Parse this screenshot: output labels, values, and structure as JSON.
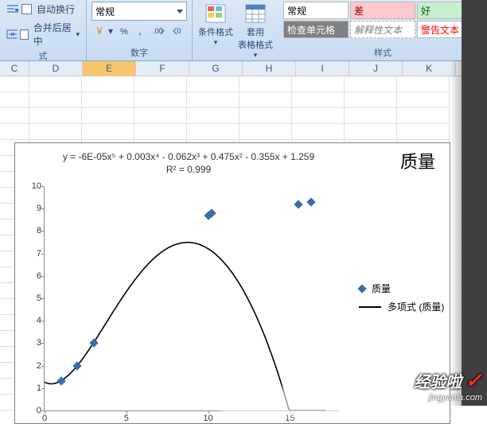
{
  "ribbon": {
    "align": {
      "wrap_label": "自动换行",
      "merge_label": "合并后居中",
      "group_label": "式"
    },
    "number": {
      "format_value": "常规",
      "group_label": "数字"
    },
    "format_btns": {
      "cond_format": "条件格式",
      "table_format_line1": "套用",
      "table_format_line2": "表格格式"
    },
    "styles": {
      "normal": "常规",
      "bad": "差",
      "good": "好",
      "check_cell": "检查单元格",
      "explain": "解释性文本",
      "warn": "警告文本",
      "group_label": "样式"
    }
  },
  "columns": [
    "C",
    "D",
    "E",
    "F",
    "G",
    "H",
    "I",
    "J",
    "K"
  ],
  "selected_column_index": 2,
  "chart_data": {
    "type": "scatter",
    "title": "质量",
    "equation_line1": "y = -6E-05x⁵ + 0.003x⁴ - 0.062x³ + 0.475x² - 0.355x + 1.259",
    "equation_line2": "R² = 0.999",
    "xlim": [
      0,
      18
    ],
    "ylim": [
      0,
      10
    ],
    "xticks": [
      0,
      5,
      10,
      15
    ],
    "yticks": [
      0,
      1,
      2,
      3,
      4,
      5,
      6,
      7,
      8,
      9,
      10
    ],
    "series": [
      {
        "name": "质量",
        "type": "points",
        "x": [
          1,
          2,
          3,
          10,
          10.2,
          15.5,
          16.3
        ],
        "y": [
          1.3,
          2.0,
          3.0,
          8.7,
          8.8,
          9.2,
          9.3
        ]
      },
      {
        "name": "多项式 (质量)",
        "type": "line",
        "coeffs": [
          -6e-05,
          0.003,
          -0.062,
          0.475,
          -0.355,
          1.259
        ]
      }
    ],
    "legend": {
      "entries": [
        "质量",
        "多项式 (质量)"
      ]
    }
  },
  "watermark": {
    "brand": "经验啦",
    "url": "jingyanla.com"
  }
}
